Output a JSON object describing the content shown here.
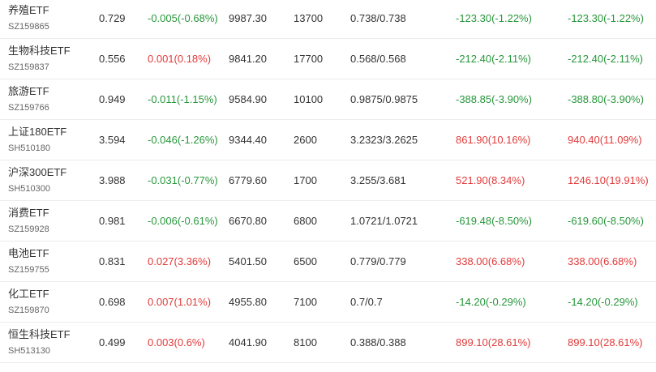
{
  "colors": {
    "up": "#e23a3a",
    "down": "#27973b",
    "text": "#333333"
  },
  "rows": [
    {
      "name": "养殖ETF",
      "code": "SZ159865",
      "price": "0.729",
      "change": "-0.005(-0.68%)",
      "change_dir": "down",
      "amount": "9987.30",
      "volume": "13700",
      "range": "0.738/0.738",
      "flow1": "-123.30(-1.22%)",
      "flow1_dir": "down",
      "flow2": "-123.30(-1.22%)",
      "flow2_dir": "down"
    },
    {
      "name": "生物科技ETF",
      "code": "SZ159837",
      "price": "0.556",
      "change": "0.001(0.18%)",
      "change_dir": "up",
      "amount": "9841.20",
      "volume": "17700",
      "range": "0.568/0.568",
      "flow1": "-212.40(-2.11%)",
      "flow1_dir": "down",
      "flow2": "-212.40(-2.11%)",
      "flow2_dir": "down"
    },
    {
      "name": "旅游ETF",
      "code": "SZ159766",
      "price": "0.949",
      "change": "-0.011(-1.15%)",
      "change_dir": "down",
      "amount": "9584.90",
      "volume": "10100",
      "range": "0.9875/0.9875",
      "flow1": "-388.85(-3.90%)",
      "flow1_dir": "down",
      "flow2": "-388.80(-3.90%)",
      "flow2_dir": "down"
    },
    {
      "name": "上证180ETF",
      "code": "SH510180",
      "price": "3.594",
      "change": "-0.046(-1.26%)",
      "change_dir": "down",
      "amount": "9344.40",
      "volume": "2600",
      "range": "3.2323/3.2625",
      "flow1": "861.90(10.16%)",
      "flow1_dir": "up",
      "flow2": "940.40(11.09%)",
      "flow2_dir": "up"
    },
    {
      "name": "沪深300ETF",
      "code": "SH510300",
      "price": "3.988",
      "change": "-0.031(-0.77%)",
      "change_dir": "down",
      "amount": "6779.60",
      "volume": "1700",
      "range": "3.255/3.681",
      "flow1": "521.90(8.34%)",
      "flow1_dir": "up",
      "flow2": "1246.10(19.91%)",
      "flow2_dir": "up"
    },
    {
      "name": "消费ETF",
      "code": "SZ159928",
      "price": "0.981",
      "change": "-0.006(-0.61%)",
      "change_dir": "down",
      "amount": "6670.80",
      "volume": "6800",
      "range": "1.0721/1.0721",
      "flow1": "-619.48(-8.50%)",
      "flow1_dir": "down",
      "flow2": "-619.60(-8.50%)",
      "flow2_dir": "down"
    },
    {
      "name": "电池ETF",
      "code": "SZ159755",
      "price": "0.831",
      "change": "0.027(3.36%)",
      "change_dir": "up",
      "amount": "5401.50",
      "volume": "6500",
      "range": "0.779/0.779",
      "flow1": "338.00(6.68%)",
      "flow1_dir": "up",
      "flow2": "338.00(6.68%)",
      "flow2_dir": "up"
    },
    {
      "name": "化工ETF",
      "code": "SZ159870",
      "price": "0.698",
      "change": "0.007(1.01%)",
      "change_dir": "up",
      "amount": "4955.80",
      "volume": "7100",
      "range": "0.7/0.7",
      "flow1": "-14.20(-0.29%)",
      "flow1_dir": "down",
      "flow2": "-14.20(-0.29%)",
      "flow2_dir": "down"
    },
    {
      "name": "恒生科技ETF",
      "code": "SH513130",
      "price": "0.499",
      "change": "0.003(0.6%)",
      "change_dir": "up",
      "amount": "4041.90",
      "volume": "8100",
      "range": "0.388/0.388",
      "flow1": "899.10(28.61%)",
      "flow1_dir": "up",
      "flow2": "899.10(28.61%)",
      "flow2_dir": "up"
    }
  ]
}
